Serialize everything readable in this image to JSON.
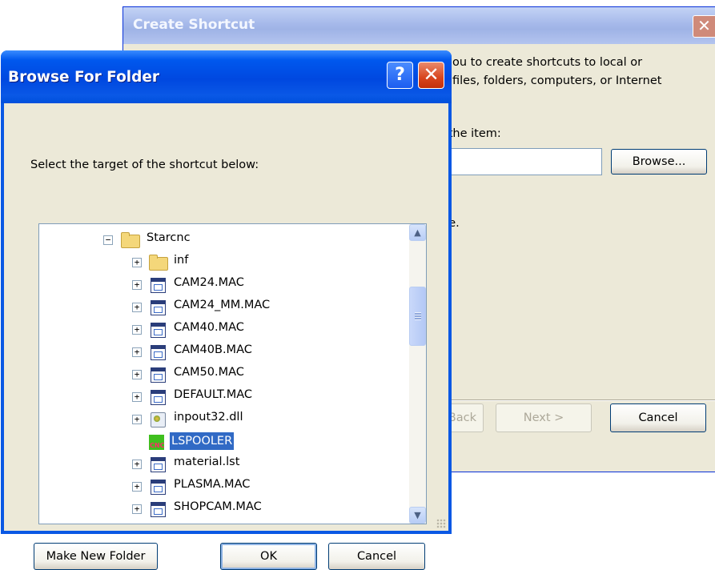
{
  "create_shortcut": {
    "title": "Create Shortcut",
    "close_glyph": "✕",
    "description_line1": "ou to create shortcuts to local or",
    "description_line2": "files, folders, computers, or Internet",
    "location_prompt": "f the item:",
    "path_value": "",
    "browse_label": "Browse...",
    "continue_text": "ue.",
    "back_label": "< Back",
    "next_label": "Next >",
    "cancel_label": "Cancel"
  },
  "browse_folder": {
    "title": "Browse For Folder",
    "help_glyph": "?",
    "close_glyph": "✕",
    "prompt": "Select the target of the shortcut below:",
    "tree": {
      "root": {
        "label": "Starcnc",
        "expander": "−",
        "icon": "folder-open-icon"
      },
      "items": [
        {
          "label": "inf",
          "expander": "+",
          "icon": "folder-icon"
        },
        {
          "label": "CAM24.MAC",
          "expander": "+",
          "icon": "file-icon"
        },
        {
          "label": "CAM24_MM.MAC",
          "expander": "+",
          "icon": "file-icon"
        },
        {
          "label": "CAM40.MAC",
          "expander": "+",
          "icon": "file-icon"
        },
        {
          "label": "CAM40B.MAC",
          "expander": "+",
          "icon": "file-icon"
        },
        {
          "label": "CAM50.MAC",
          "expander": "+",
          "icon": "file-icon"
        },
        {
          "label": "DEFAULT.MAC",
          "expander": "+",
          "icon": "file-icon"
        },
        {
          "label": "inpout32.dll",
          "expander": "+",
          "icon": "dll-icon"
        },
        {
          "label": "LSPOOLER",
          "expander": "",
          "icon": "cnc-app-icon",
          "selected": true,
          "icon_text": "CNC"
        },
        {
          "label": "material.lst",
          "expander": "+",
          "icon": "file-icon"
        },
        {
          "label": "PLASMA.MAC",
          "expander": "+",
          "icon": "file-icon"
        },
        {
          "label": "SHOPCAM.MAC",
          "expander": "+",
          "icon": "file-icon"
        }
      ]
    },
    "scroll_up_glyph": "▲",
    "scroll_down_glyph": "▼",
    "make_new_folder_label": "Make New Folder",
    "ok_label": "OK",
    "cancel_label": "Cancel"
  }
}
